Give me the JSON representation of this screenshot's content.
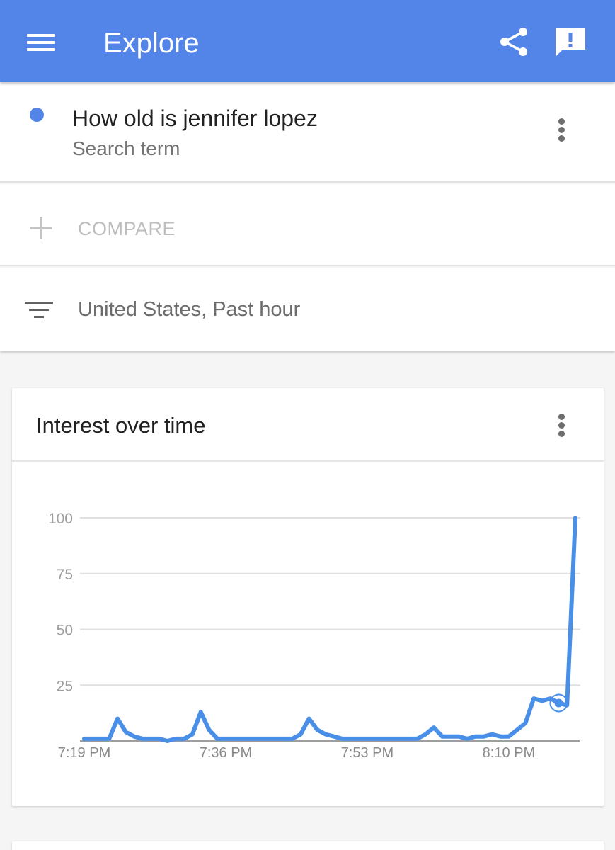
{
  "appbar": {
    "title": "Explore",
    "menu_icon": "hamburger-menu-icon",
    "share_icon": "share-icon",
    "feedback_icon": "feedback-icon",
    "color": "#5385e8"
  },
  "search_term": {
    "name": "How old is jennifer lopez",
    "subtitle": "Search term",
    "dot_color": "#5385e8",
    "more_icon": "more-vert-icon"
  },
  "compare": {
    "label": "COMPARE",
    "icon": "plus-icon"
  },
  "filter": {
    "label": "United States, Past hour",
    "icon": "filter-icon"
  },
  "interest_card": {
    "title": "Interest over time",
    "more_icon": "more-vert-icon"
  },
  "chart_data": {
    "type": "line",
    "title": "Interest over time",
    "xlabel": "",
    "ylabel": "",
    "ylim": [
      0,
      100
    ],
    "yticks": [
      25,
      50,
      75,
      100
    ],
    "xticks": [
      "7:19 PM",
      "7:36 PM",
      "7:53 PM",
      "8:10 PM"
    ],
    "grid": true,
    "series_color": "#4a8fe7",
    "series": [
      {
        "values": [
          1,
          1,
          1,
          1,
          10,
          4,
          2,
          1,
          1,
          1,
          0,
          1,
          1,
          3,
          13,
          5,
          1,
          1,
          1,
          1,
          1,
          1,
          1,
          1,
          1,
          1,
          3,
          10,
          5,
          3,
          2,
          1,
          1,
          1,
          1,
          1,
          1,
          1,
          1,
          1,
          1,
          3,
          6,
          2,
          2,
          2,
          1,
          2,
          2,
          3,
          2,
          2,
          5,
          8,
          19,
          18,
          19,
          17,
          16,
          100
        ]
      }
    ],
    "highlight_index": 57
  }
}
